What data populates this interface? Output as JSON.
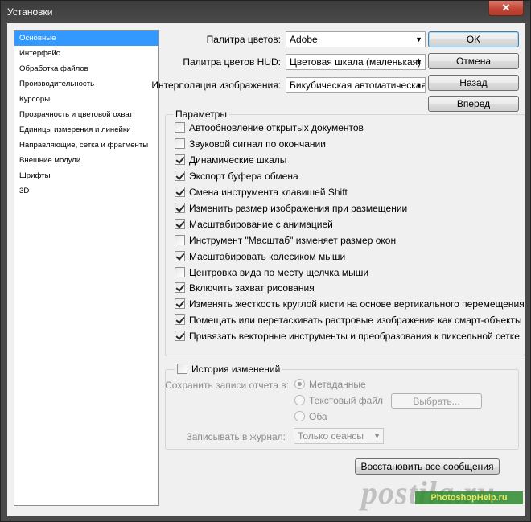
{
  "window": {
    "title": "Установки",
    "close_glyph": "✕"
  },
  "sidebar": {
    "items": [
      {
        "label": "Основные",
        "selected": true
      },
      {
        "label": "Интерфейс"
      },
      {
        "label": "Обработка файлов"
      },
      {
        "label": "Производительность"
      },
      {
        "label": "Курсоры"
      },
      {
        "label": "Прозрачность и цветовой охват"
      },
      {
        "label": "Единицы измерения и линейки"
      },
      {
        "label": "Направляющие, сетка и фрагменты"
      },
      {
        "label": "Внешние модули"
      },
      {
        "label": "Шрифты"
      },
      {
        "label": "3D"
      }
    ]
  },
  "settings": {
    "palette_label": "Палитра цветов:",
    "palette_value": "Adobe",
    "hud_label": "Палитра цветов HUD:",
    "hud_value": "Цветовая шкала (маленькая)",
    "interp_label": "Интерполяция изображения:",
    "interp_value": "Бикубическая автоматическая"
  },
  "buttons": {
    "ok": "OK",
    "cancel": "Отмена",
    "prev": "Назад",
    "next": "Вперед"
  },
  "params": {
    "title": "Параметры",
    "options": [
      {
        "label": "Автообновление открытых документов",
        "checked": false
      },
      {
        "label": "Звуковой сигнал по окончании",
        "checked": false
      },
      {
        "label": "Динамические шкалы",
        "checked": true
      },
      {
        "label": "Экспорт буфера обмена",
        "checked": true
      },
      {
        "label": "Смена инструмента клавишей Shift",
        "checked": true
      },
      {
        "label": "Изменить размер изображения при размещении",
        "checked": true
      },
      {
        "label": "Масштабирование с анимацией",
        "checked": true
      },
      {
        "label": "Инструмент \"Масштаб\" изменяет размер окон",
        "checked": false
      },
      {
        "label": "Масштабировать колесиком мыши",
        "checked": true
      },
      {
        "label": "Центровка вида по месту щелчка мыши",
        "checked": false
      },
      {
        "label": "Включить захват рисования",
        "checked": true
      },
      {
        "label": "Изменять жесткость круглой кисти на основе вертикального перемещения H",
        "checked": true
      },
      {
        "label": "Помещать или перетаскивать растровые изображения как смарт-объекты",
        "checked": true
      },
      {
        "label": "Привязать векторные инструменты и преобразования к пиксельной сетке",
        "checked": true
      }
    ]
  },
  "history": {
    "title": "История изменений",
    "save_label": "Сохранить записи отчета в:",
    "opt_meta": "Метаданные",
    "opt_text": "Текстовый файл",
    "opt_both": "Оба",
    "choose_button": "Выбрать...",
    "journal_label": "Записывать в журнал:",
    "journal_value": "Только сеансы"
  },
  "reset_button": "Восстановить все сообщения",
  "watermark": {
    "main": "postila.ru",
    "badge": "PhotoshopHelp.ru"
  }
}
